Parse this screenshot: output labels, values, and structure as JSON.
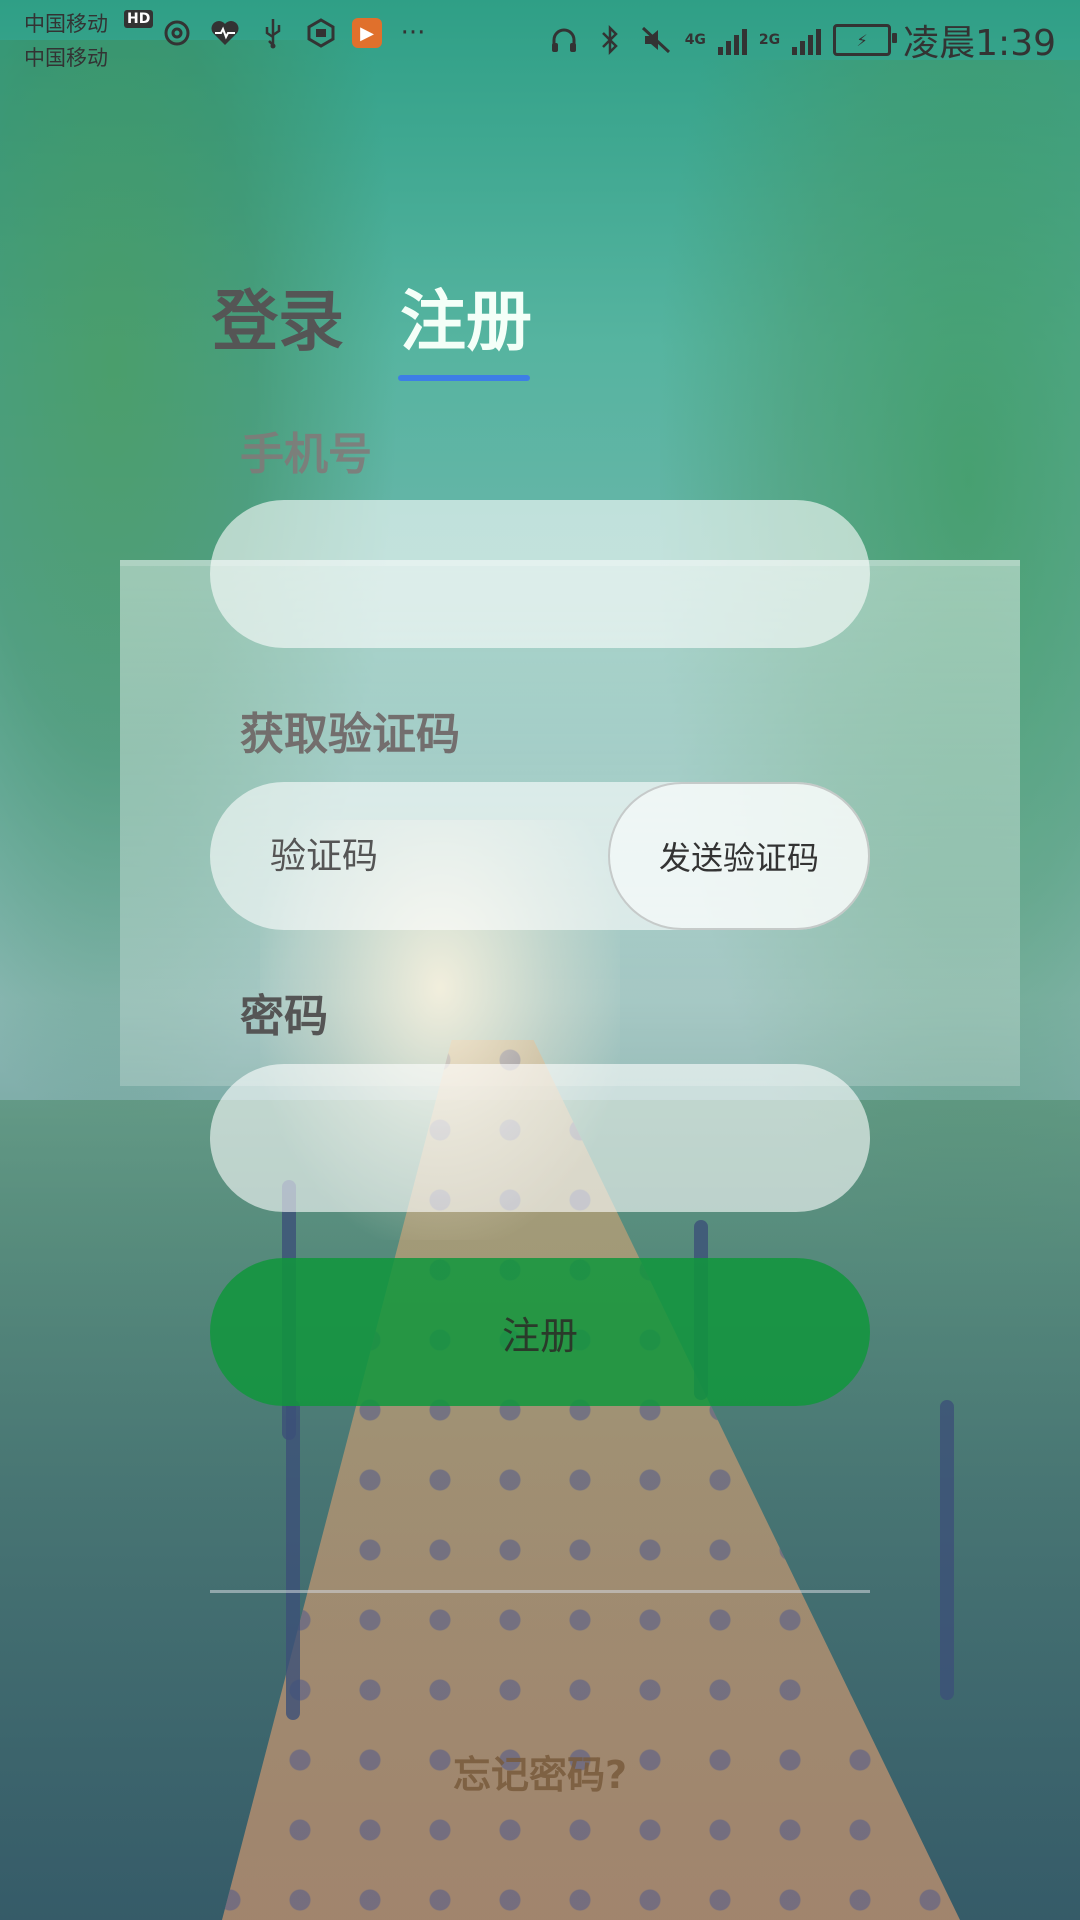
{
  "status_bar": {
    "carrier_1": "中国移动",
    "carrier_2": "中国移动",
    "hd_badge": "HD",
    "network_1": "4G",
    "network_2": "2G",
    "time": "凌晨1:39",
    "left_icons": [
      "netease-music-icon",
      "heart-rate-icon",
      "usb-icon",
      "hexagon-app-icon",
      "video-app-icon",
      "more-dots-icon"
    ],
    "right_icons": [
      "headphones-icon",
      "bluetooth-icon",
      "mute-icon",
      "signal-4g-icon",
      "signal-2g-icon",
      "battery-charging-icon"
    ],
    "more": "···"
  },
  "tabs": {
    "login": "登录",
    "register": "注册",
    "active": "register",
    "accent_color": "#3d7ee6"
  },
  "form": {
    "phone_label": "手机号",
    "phone_value": "",
    "code_label": "获取验证码",
    "code_placeholder": "验证码",
    "send_code_label": "发送验证码",
    "password_label": "密码",
    "password_value": "",
    "submit_label": "注册",
    "submit_color": "#109640"
  },
  "footer": {
    "forgot_password": "忘记密码?"
  }
}
